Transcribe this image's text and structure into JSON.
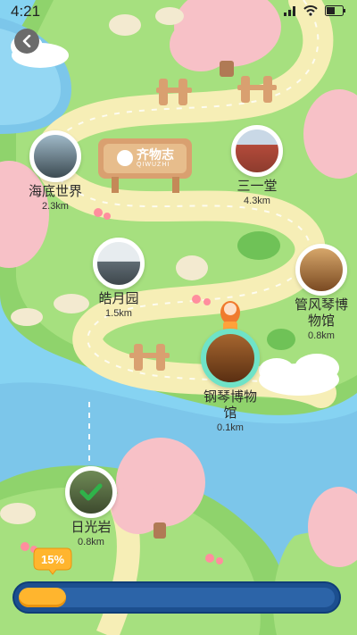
{
  "status_bar": {
    "time": "4:21",
    "icons": [
      "signal-icon",
      "wifi-icon",
      "battery-icon"
    ]
  },
  "nav": {
    "back_icon": "chevron-left-icon"
  },
  "sign": {
    "brand": "齐物志",
    "pinyin": "QIWUZHI"
  },
  "pois": [
    {
      "id": "haidi",
      "name": "海底世界",
      "distance": "2.3km",
      "visited": false
    },
    {
      "id": "sanyitang",
      "name": "三一堂",
      "distance": "4.3km",
      "visited": false
    },
    {
      "id": "haoyue",
      "name": "皓月园",
      "distance": "1.5km",
      "visited": false
    },
    {
      "id": "guanfengqin",
      "name": "管风琴博物馆",
      "distance": "0.8km",
      "visited": false
    },
    {
      "id": "gangqin",
      "name": "钢琴博物馆",
      "distance": "0.1km",
      "visited": false,
      "current": true
    },
    {
      "id": "riguangyan",
      "name": "日光岩",
      "distance": "0.8km",
      "visited": true
    }
  ],
  "progress": {
    "label": "15%",
    "fraction": 0.15
  },
  "colors": {
    "progress_fill": "#ffb52e",
    "progress_track": "#1c4f8f",
    "active_ring": "#6fe3c7",
    "check": "#2fb34a"
  }
}
